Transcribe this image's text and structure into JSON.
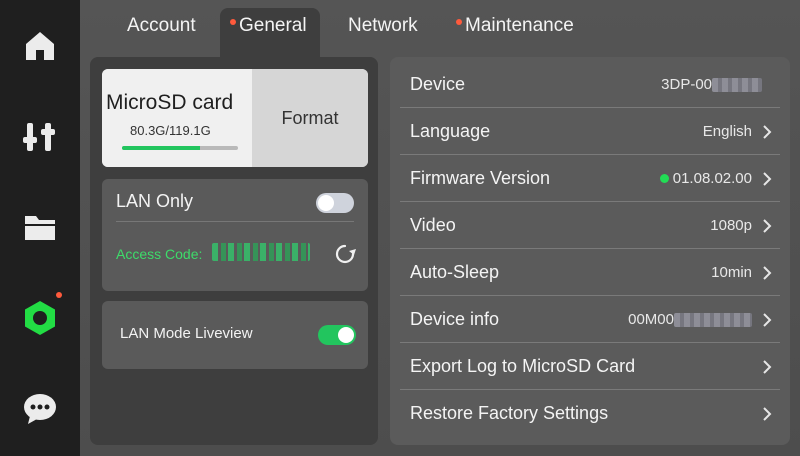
{
  "nav": {
    "items": [
      {
        "icon": "home-icon"
      },
      {
        "icon": "sliders-icon"
      },
      {
        "icon": "folder-icon"
      },
      {
        "icon": "settings-icon",
        "active": true,
        "notification": true
      },
      {
        "icon": "chat-icon"
      }
    ]
  },
  "tabs": [
    {
      "label": "Account",
      "dot": false
    },
    {
      "label": "General",
      "dot": true,
      "active": true
    },
    {
      "label": "Network",
      "dot": false
    },
    {
      "label": "Maintenance",
      "dot": true
    }
  ],
  "storage": {
    "title": "MicroSD card",
    "usage": "80.3G/119.1G",
    "used_fraction": 0.674,
    "format_label": "Format"
  },
  "lan": {
    "title": "LAN Only",
    "enabled": false,
    "access_label": "Access Code:"
  },
  "liveview": {
    "label": "LAN Mode Liveview",
    "enabled": true
  },
  "settings": [
    {
      "label": "Device",
      "value": "3DP-00",
      "chevron": false,
      "redacted": true
    },
    {
      "label": "Language",
      "value": "English",
      "chevron": true
    },
    {
      "label": "Firmware Version",
      "value": "01.08.02.00",
      "chevron": true,
      "status_dot": true
    },
    {
      "label": "Video",
      "value": "1080p",
      "chevron": true
    },
    {
      "label": "Auto-Sleep",
      "value": "10min",
      "chevron": true
    },
    {
      "label": "Device info",
      "value": "00M00",
      "chevron": true,
      "redacted": true
    },
    {
      "label": "Export Log to MicroSD Card",
      "value": "",
      "chevron": true
    },
    {
      "label": "Restore Factory Settings",
      "value": "",
      "chevron": true
    }
  ],
  "colors": {
    "accent_green": "#22c55e",
    "notification_red": "#ff5a3c",
    "toggle_on": "#22c55e",
    "toggle_off": "#cfd3dc"
  }
}
